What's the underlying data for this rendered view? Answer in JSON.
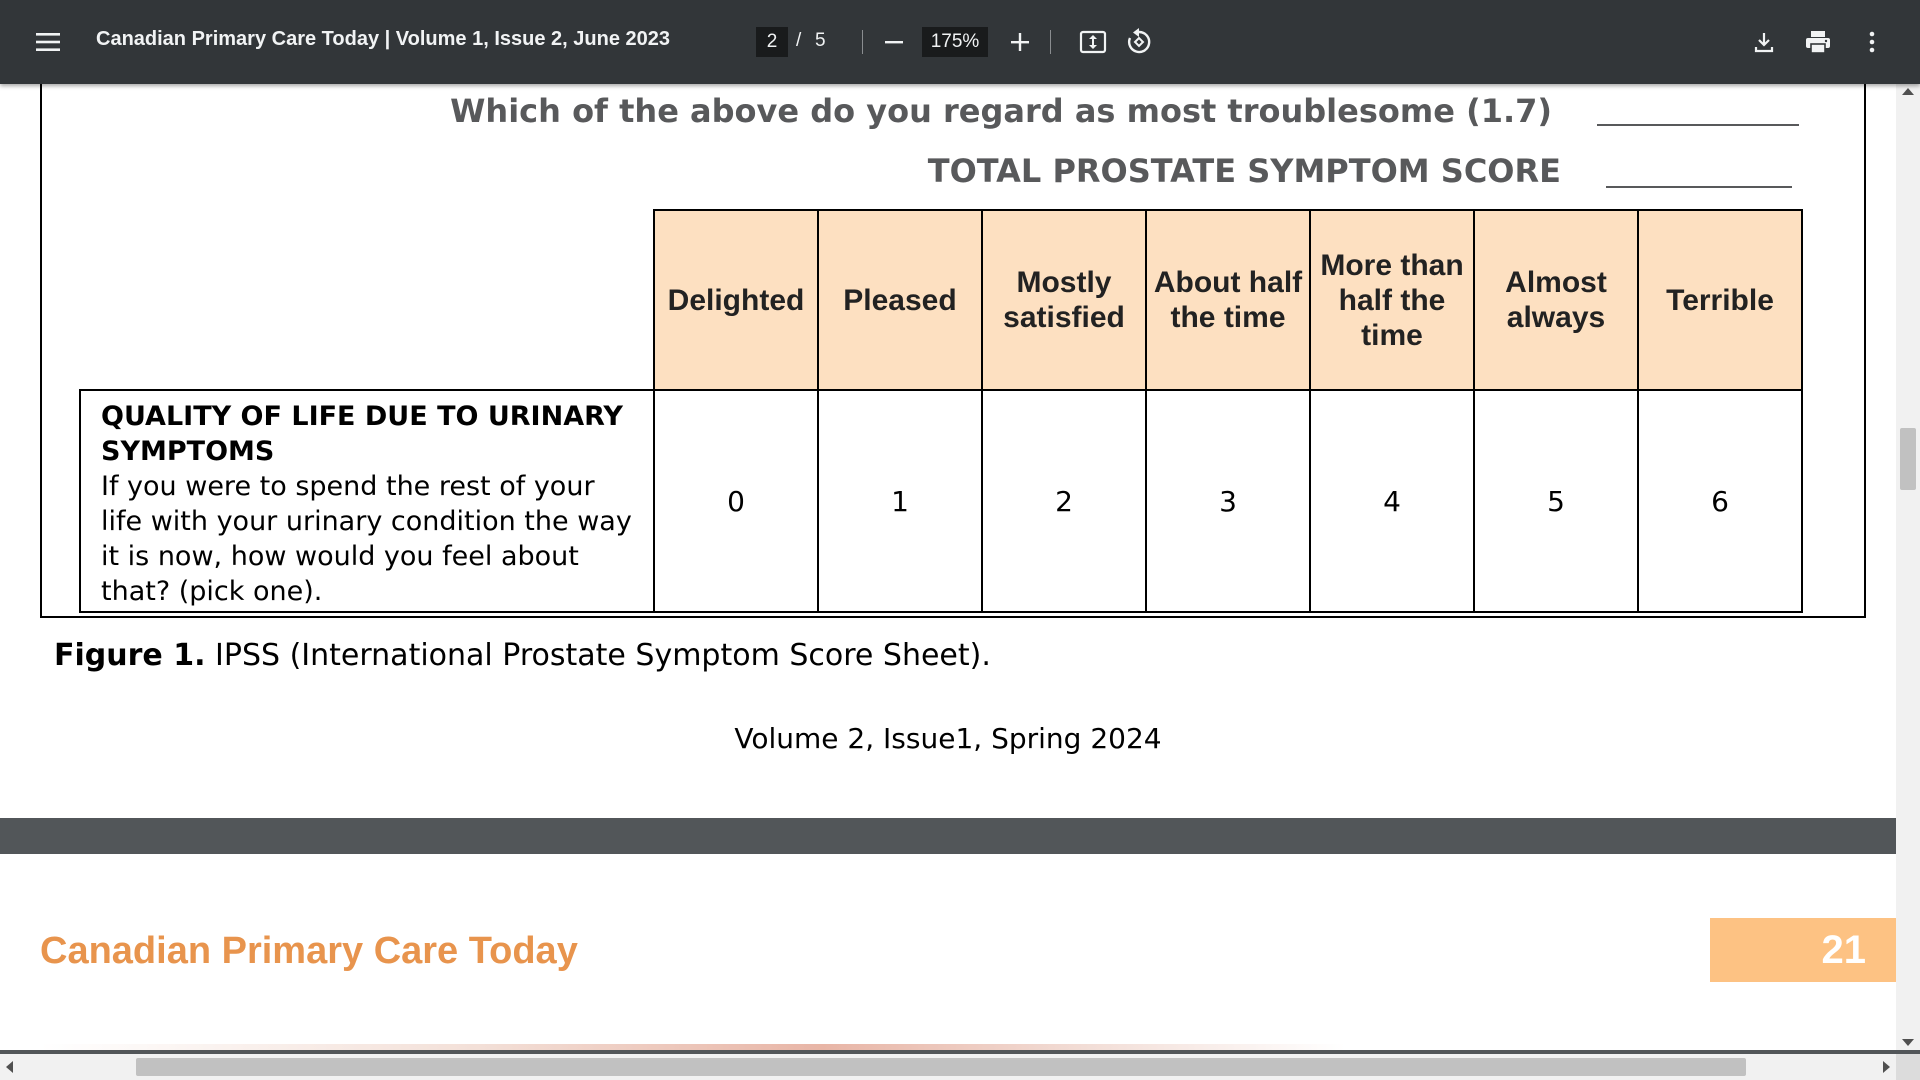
{
  "toolbar": {
    "title": "Canadian Primary Care Today | Volume 1, Issue 2, June 2023",
    "current_page": "2",
    "page_separator": "/",
    "total_pages": "5",
    "zoom": "175%",
    "icons": {
      "menu": "hamburger-menu-icon",
      "zoom_out": "minus-icon",
      "zoom_in": "plus-icon",
      "fit": "fit-to-page-icon",
      "rotate": "rotate-counterclockwise-icon",
      "download": "download-icon",
      "print": "print-icon",
      "more": "more-vertical-icon"
    },
    "colors": {
      "bar": "#323639",
      "text": "#f1f3f4"
    }
  },
  "document": {
    "page1": {
      "question_troublesome": "Which of the above do you regard as most troublesome (1.7)",
      "total_score_label": "TOTAL PROSTATE SYMPTOM SCORE",
      "table": {
        "headers": [
          "Delighted",
          "Pleased",
          "Mostly satisfied",
          "About half the time",
          "More than half the time",
          "Almost always",
          "Terrible"
        ],
        "row": {
          "heading": "QUALITY OF LIFE DUE TO URINARY SYMPTOMS",
          "body": "If you were to spend the rest of your life with your urinary condition the way it is now, how would you feel about that? (pick one).",
          "scores": [
            "0",
            "1",
            "2",
            "3",
            "4",
            "5",
            "6"
          ]
        },
        "header_color": "#fde0c1"
      },
      "caption_label": "Figure 1.",
      "caption_text": "IPSS (International Prostate Symptom Score Sheet).",
      "footer": "Volume 2, Issue1, Spring 2024"
    },
    "page2": {
      "journal_name": "Canadian Primary Care Today",
      "page_number": "21",
      "accent_color": "#e8944d",
      "badge_color": "#fdc283"
    }
  }
}
